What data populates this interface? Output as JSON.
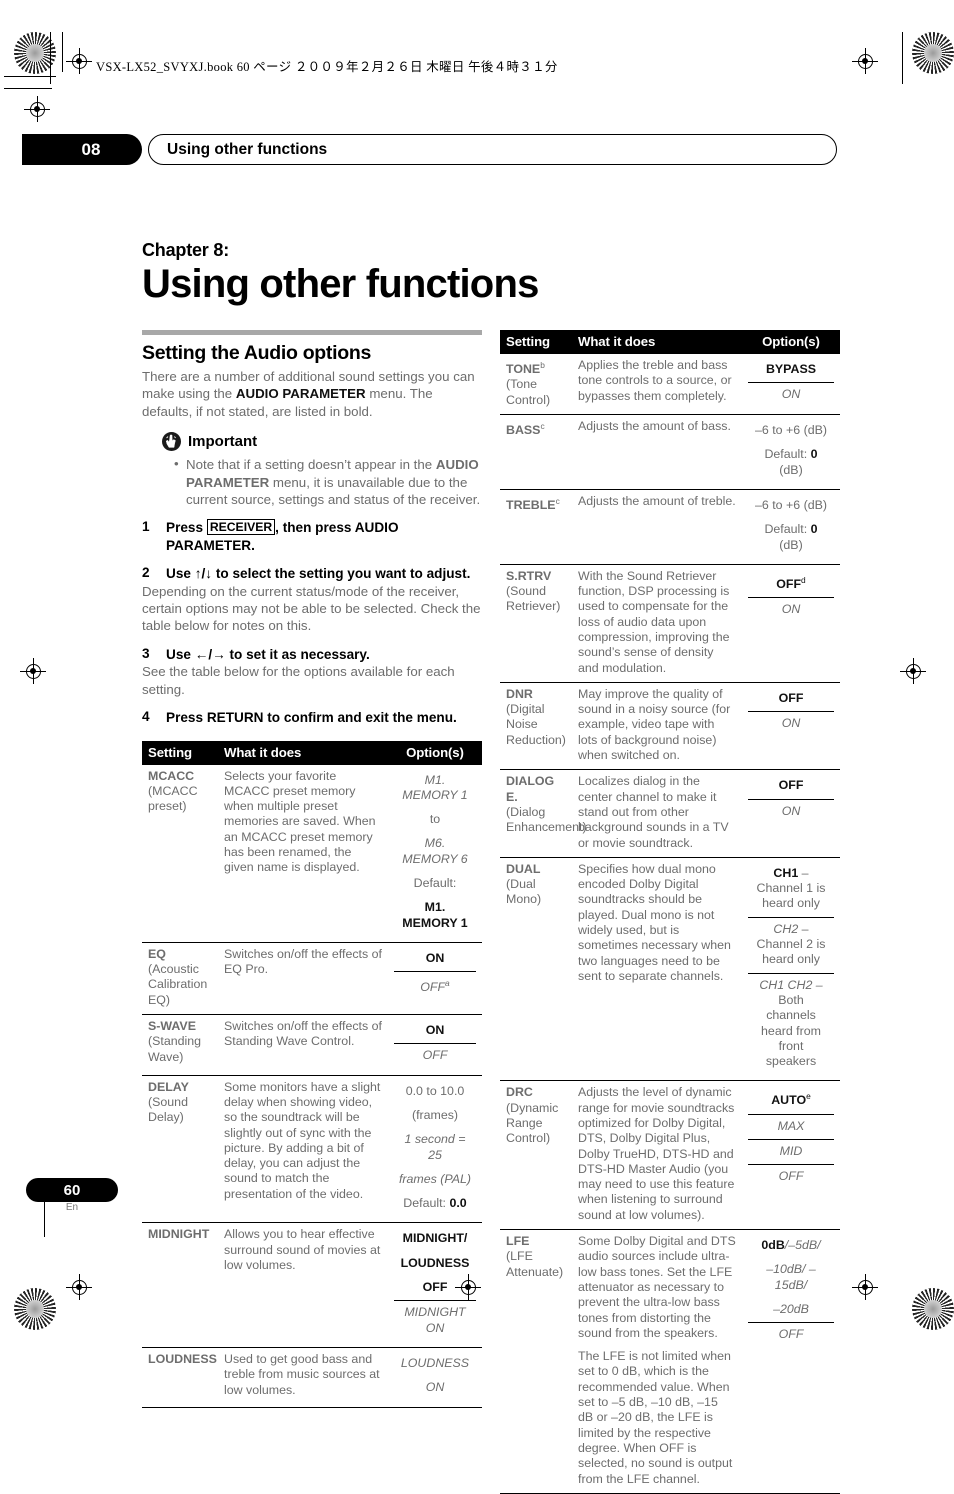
{
  "print_header": "VSX-LX52_SVYXJ.book   60 ページ   ２００９年２月２６日   木曜日   午後４時３１分",
  "running_head": {
    "chapter_number": "08",
    "title": "Using other functions"
  },
  "chapter": {
    "label": "Chapter 8:",
    "title": "Using other functions"
  },
  "left_column": {
    "section_title": "Setting the Audio options",
    "intro_1": "There are a number of additional sound settings you can make using the ",
    "intro_bold": "AUDIO PARAMETER",
    "intro_2": " menu. The defaults, if not stated, are listed in bold.",
    "important_label": "Important",
    "important_bullet_1": "Note that if a setting doesn’t appear in the ",
    "important_bullet_bold": "AUDIO PARAMETER",
    "important_bullet_2": " menu, it is unavailable due to the current source, settings and status of the receiver.",
    "steps": [
      {
        "num": "1",
        "keycap": "RECEIVER",
        "pre": "Press ",
        "post": ", then press AUDIO PARAMETER.",
        "sub": ""
      },
      {
        "num": "2",
        "pre": "Use ",
        "arrows": "↑/↓",
        "post": " to select the setting you want to adjust.",
        "sub": "Depending on the current status/mode of the receiver, certain options may not be able to be selected. Check the table below for notes on this."
      },
      {
        "num": "3",
        "pre": "Use ",
        "arrows": "←/→",
        "post": " to set it as necessary.",
        "sub": "See the table below for the options available for each setting."
      },
      {
        "num": "4",
        "pre": "",
        "post": "Press RETURN to confirm and exit the menu.",
        "sub": ""
      }
    ]
  },
  "table_headers": {
    "setting": "Setting",
    "what": "What it does",
    "options": "Option(s)"
  },
  "left_table": [
    {
      "setting": "MCACC",
      "setting_sub": "(MCACC preset)",
      "what": "Selects your favorite MCACC preset memory when multiple preset memories are saved. When an MCACC preset memory has been renamed, the given name is displayed.",
      "options": [
        {
          "text": "M1. MEMORY 1",
          "style": "ital",
          "divider": false
        },
        {
          "text": "to",
          "style": "plain",
          "divider": false
        },
        {
          "text": "M6. MEMORY 6",
          "style": "ital",
          "divider": false
        },
        {
          "text": "Default:",
          "style": "plain",
          "divider": false
        },
        {
          "text": "M1. MEMORY 1",
          "style": "bold",
          "divider": false
        }
      ]
    },
    {
      "setting": "EQ",
      "setting_sub": "(Acoustic Calibration EQ)",
      "what": "Switches on/off the effects of EQ Pro.",
      "options": [
        {
          "text": "ON",
          "style": "bold",
          "divider": false
        },
        {
          "text": "OFF",
          "sup": "a",
          "style": "ital",
          "divider": true
        }
      ]
    },
    {
      "setting": "S-WAVE",
      "setting_sub": "(Standing Wave)",
      "what": "Switches on/off the effects of Standing Wave Control.",
      "options": [
        {
          "text": "ON",
          "style": "bold",
          "divider": false
        },
        {
          "text": "OFF",
          "style": "ital",
          "divider": true
        }
      ]
    },
    {
      "setting": "DELAY",
      "setting_sub": "(Sound Delay)",
      "what": "Some monitors have a slight delay when showing video, so the soundtrack will be slightly out of sync with the picture. By adding a bit of delay, you can adjust the sound to match the presentation of the video.",
      "options": [
        {
          "text": "0.0 to 10.0",
          "style": "plain",
          "divider": false
        },
        {
          "text": "(frames)",
          "style": "plain",
          "divider": false
        },
        {
          "text": "1 second = 25",
          "style": "ital",
          "divider": false
        },
        {
          "text": "frames (PAL)",
          "style": "ital",
          "divider": false
        },
        {
          "text": "Default: 0.0",
          "style": "plain",
          "bold_tail": "0.0",
          "divider": false
        }
      ]
    },
    {
      "setting": "MIDNIGHT",
      "setting_sub": "",
      "what": "Allows you to hear effective surround sound of movies at low volumes.",
      "options": [
        {
          "text": "MIDNIGHT/",
          "style": "bold",
          "divider": false
        },
        {
          "text": "LOUDNESS",
          "style": "bold",
          "divider": false
        },
        {
          "text": "OFF",
          "style": "bold",
          "divider": false
        },
        {
          "text": "MIDNIGHT ON",
          "style": "ital",
          "divider": true
        }
      ]
    },
    {
      "setting": "LOUDNESS",
      "setting_sub": "",
      "what": "Used to get good bass and treble from music sources at low volumes.",
      "options": [
        {
          "text": "LOUDNESS",
          "style": "ital",
          "divider": true
        },
        {
          "text": "ON",
          "style": "ital",
          "divider": false
        }
      ]
    }
  ],
  "right_table": [
    {
      "setting": "TONE",
      "setting_sup": "b",
      "setting_sub": "(Tone Control)",
      "what": "Applies the treble and bass tone controls to a source, or bypasses them completely.",
      "options": [
        {
          "text": "BYPASS",
          "style": "bold",
          "divider": false
        },
        {
          "text": "ON",
          "style": "ital",
          "divider": true
        }
      ]
    },
    {
      "setting": "BASS",
      "setting_sup": "c",
      "setting_sub": "",
      "what": "Adjusts the amount of bass.",
      "options": [
        {
          "text": "–6 to +6 (dB)",
          "style": "plain",
          "divider": false
        },
        {
          "text": "Default: 0 (dB)",
          "style": "plain",
          "bold_mid": "0",
          "divider": false
        }
      ]
    },
    {
      "setting": "TREBLE",
      "setting_sup": "c",
      "setting_sub": "",
      "what": "Adjusts the amount of treble.",
      "options": [
        {
          "text": "–6 to +6 (dB)",
          "style": "plain",
          "divider": false
        },
        {
          "text": "Default: 0 (dB)",
          "style": "plain",
          "bold_mid": "0",
          "divider": false
        }
      ]
    },
    {
      "setting": "S.RTRV",
      "setting_sub": "(Sound Retriever)",
      "what": "With the Sound Retriever function, DSP processing is used to compensate for the loss of audio data upon compression, improving the sound’s sense of density and modulation.",
      "options": [
        {
          "text": "OFF",
          "sup": "d",
          "style": "bold",
          "divider": false
        },
        {
          "text": "ON",
          "style": "ital",
          "divider": true
        }
      ]
    },
    {
      "setting": "DNR",
      "setting_sub": "(Digital Noise Reduction)",
      "what": "May improve the quality of sound in a noisy source (for example, video tape with lots of background noise) when switched on.",
      "options": [
        {
          "text": "OFF",
          "style": "bold",
          "divider": false
        },
        {
          "text": "ON",
          "style": "ital",
          "divider": true
        }
      ]
    },
    {
      "setting": "DIALOG E.",
      "setting_sub": "(Dialog Enhancement)",
      "what": "Localizes dialog in the center channel to make it stand out from other background sounds in a TV or movie soundtrack.",
      "options": [
        {
          "text": "OFF",
          "style": "bold",
          "divider": false
        },
        {
          "text": "ON",
          "style": "ital",
          "divider": true
        }
      ]
    },
    {
      "setting": "DUAL",
      "setting_sub": "(Dual Mono)",
      "what": "Specifies how dual mono encoded Dolby Digital soundtracks should be played. Dual mono is not widely used, but is sometimes necessary when two languages need to be sent to separate channels.",
      "options": [
        {
          "text": "CH1 – Channel 1 is heard only",
          "style": "plain",
          "bold_head": "CH1",
          "divider": false
        },
        {
          "text": "CH2 – Channel 2 is heard only",
          "style": "plain",
          "ital_head": "CH2",
          "divider": true
        },
        {
          "text": "CH1 CH2 – Both channels heard from front speakers",
          "style": "plain",
          "ital_head": "CH1 CH2 –",
          "divider": true
        }
      ]
    },
    {
      "setting": "DRC",
      "setting_sub": "(Dynamic Range Control)",
      "what": "Adjusts the level of dynamic range for movie soundtracks optimized for Dolby Digital, DTS, Dolby Digital Plus, Dolby TrueHD, DTS-HD and DTS-HD Master Audio (you may need to use this feature when listening to surround sound at low volumes).",
      "options": [
        {
          "text": "AUTO",
          "sup": "e",
          "style": "bold",
          "divider": false
        },
        {
          "text": "MAX",
          "style": "ital",
          "divider": true
        },
        {
          "text": "MID",
          "style": "ital",
          "divider": true
        },
        {
          "text": "OFF",
          "style": "ital",
          "divider": true
        }
      ]
    },
    {
      "setting": "LFE",
      "setting_sub": "(LFE Attenuate)",
      "what": "Some Dolby Digital and DTS audio sources include ultra-low bass tones. Set the LFE attenuator as necessary to prevent the ultra-low bass tones from distorting the sound from the speakers.",
      "what2": "The LFE is not limited when set to 0 dB, which is the recommended value. When set to –5 dB, –10 dB, –15 dB or –20 dB, the LFE is limited by the respective degree. When OFF is selected, no sound is output from the LFE channel.",
      "options": [
        {
          "text": "0dB/ –5dB/",
          "style": "plain",
          "bold_head": "0dB",
          "ital_tail": "/–5dB/",
          "divider": false
        },
        {
          "text": "–10dB/ –15dB/",
          "style": "ital",
          "divider": false
        },
        {
          "text": "–20dB",
          "style": "ital",
          "divider": false
        },
        {
          "text": "OFF",
          "style": "ital",
          "divider": true
        }
      ]
    }
  ],
  "footer": {
    "page_number": "60",
    "language": "En"
  }
}
